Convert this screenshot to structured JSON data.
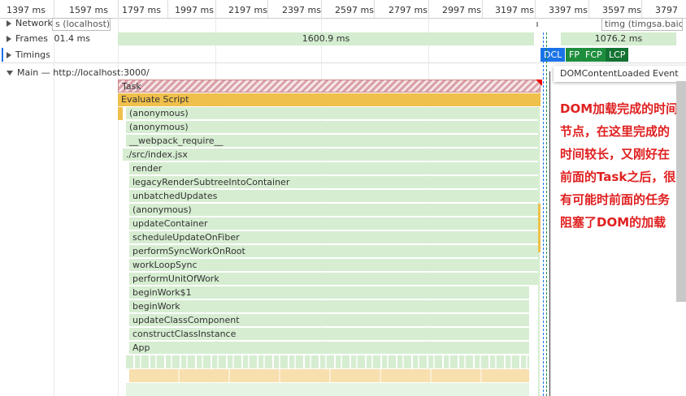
{
  "ruler": {
    "ticks": [
      "1397 ms",
      "1597 ms",
      "1797 ms",
      "1997 ms",
      "2197 ms",
      "2397 ms",
      "2597 ms",
      "2797 ms",
      "2997 ms",
      "3197 ms",
      "3397 ms",
      "3597 ms",
      "3797"
    ]
  },
  "tracks": {
    "network_label": "Network",
    "network_item1": "s (localhost)",
    "network_item2": "timg (timgsa.baidu",
    "frames_label": "Frames",
    "frames_value1": "01.4 ms",
    "frames_value2": "1600.9 ms",
    "frames_value3": "1076.2 ms",
    "timings_label": "Timings",
    "main_label": "Main — http://localhost:3000/"
  },
  "timings": {
    "dcl": "DCL",
    "fp": "FP",
    "fcp": "FCP",
    "lcp": "LCP"
  },
  "tooltip": "DOMContentLoaded Event",
  "flame": {
    "task": "Task",
    "evaluate": "Evaluate Script",
    "frames": [
      "(anonymous)",
      "(anonymous)",
      "__webpack_require__",
      "./src/index.jsx",
      "render",
      "legacyRenderSubtreeIntoContainer",
      "unbatchedUpdates",
      "(anonymous)",
      "updateContainer",
      "scheduleUpdateOnFiber",
      "performSyncWorkOnRoot",
      "workLoopSync",
      "performUnitOfWork",
      "beginWork$1",
      "beginWork",
      "updateClassComponent",
      "constructClassInstance",
      "App"
    ]
  },
  "annotation": "DOM加载完成的时间节点，在这里完成的时间较长，又刚好在前面的Task之后，很有可能时前面的任务阻塞了DOM的加载",
  "colors": {
    "dcl": "#1a73e8",
    "fp": "#1e8e3e",
    "fcp": "#1e8e3e",
    "lcp": "#137333",
    "evaluate": "#f0c04c",
    "task_hatch": "#d9a0a8",
    "annotation": "#e02020"
  }
}
